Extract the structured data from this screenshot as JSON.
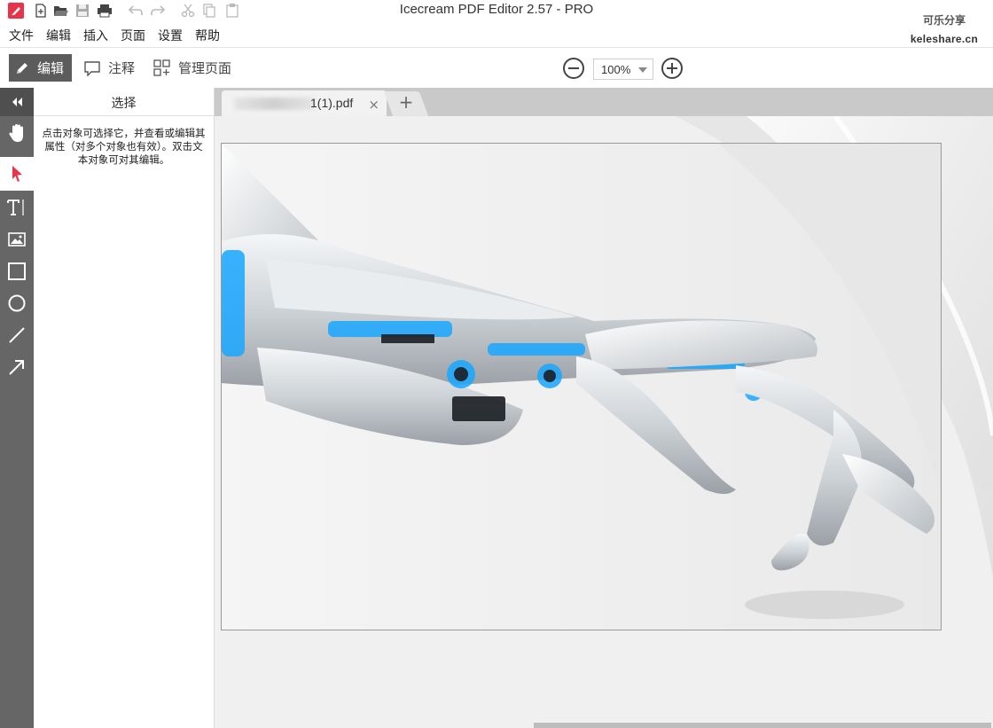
{
  "window": {
    "title": "Icecream PDF Editor 2.57 - PRO"
  },
  "watermark": {
    "line1": "可乐分享",
    "line2": "keleshare.cn"
  },
  "quick_access": [
    "app-logo-icon",
    "new-icon",
    "open-icon",
    "save-icon",
    "print-icon",
    "undo-icon",
    "redo-icon",
    "cut-icon",
    "copy-icon",
    "paste-icon"
  ],
  "menu": {
    "items": [
      "文件",
      "编辑",
      "插入",
      "页面",
      "设置",
      "帮助"
    ]
  },
  "toolbar": {
    "modes": [
      {
        "label": "编辑",
        "icon": "pencil-icon",
        "active": true
      },
      {
        "label": "注释",
        "icon": "comment-icon",
        "active": false
      },
      {
        "label": "管理页面",
        "icon": "pages-icon",
        "active": false
      }
    ],
    "zoom": {
      "value": "100%"
    }
  },
  "tools": [
    "collapse-icon",
    "hand-icon",
    "select-arrow-icon",
    "text-tool-icon",
    "image-tool-icon",
    "rectangle-tool-icon",
    "ellipse-tool-icon",
    "line-tool-icon",
    "arrow-tool-icon"
  ],
  "panel": {
    "title": "选择",
    "description": "点击对象可选择它，并查看或编辑其属性（对多个对象也有效）。双击文本对象可对其编辑。"
  },
  "document": {
    "tab_label": "1(1).pdf",
    "tab_close": "×",
    "new_tab": "+"
  },
  "colors": {
    "accent": "#e8334a",
    "tool_strip": "#666666",
    "active_mode": "#5c5c5c",
    "robot_glow": "#1aa7ff"
  }
}
